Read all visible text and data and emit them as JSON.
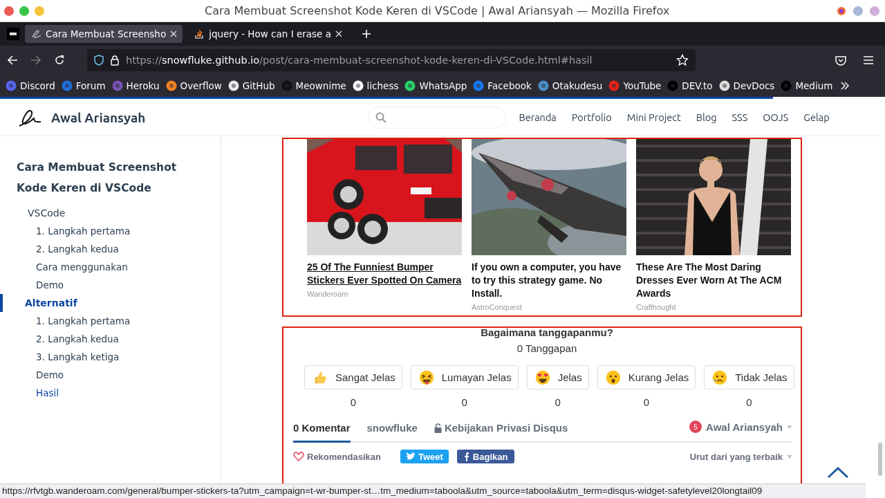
{
  "window": {
    "title": "Cara Membuat Screenshot Kode Keren di VSCode | Awal Ariansyah — Mozilla Firefox"
  },
  "tabs": [
    {
      "label": "Cara Membuat Screensho",
      "selected": true
    },
    {
      "label": "jquery - How can I erase a",
      "selected": false
    }
  ],
  "address_bar": {
    "scheme": "https://",
    "domain": "snowfluke.github.io",
    "path": "/post/cara-membuat-screenshot-kode-keren-di-VSCode.html#hasil"
  },
  "bookmarks": [
    "Discord",
    "Forum",
    "Heroku",
    "Overflow",
    "GitHub",
    "Meownime",
    "lichess",
    "WhatsApp",
    "Facebook",
    "Otakudesu",
    "YouTube",
    "DEV.to",
    "DevDocs",
    "Medium"
  ],
  "site": {
    "name": "Awal Ariansyah",
    "nav": [
      "Beranda",
      "Portfolio",
      "Mini Project",
      "Blog",
      "SSS",
      "OOJS",
      "Gelap"
    ]
  },
  "toc": {
    "title": "Cara Membuat Screenshot Kode Keren di VSCode",
    "items": [
      {
        "label": "VSCode",
        "selected": false,
        "children": [
          {
            "label": "1. Langkah pertama",
            "selected": false
          },
          {
            "label": "2. Langkah kedua",
            "selected": false
          },
          {
            "label": "Cara menggunakan",
            "selected": false
          },
          {
            "label": "Demo",
            "selected": false
          }
        ]
      },
      {
        "label": "Alternatif",
        "selected": true,
        "children": [
          {
            "label": "1. Langkah pertama",
            "selected": false
          },
          {
            "label": "2. Langkah kedua",
            "selected": false
          },
          {
            "label": "3. Langkah ketiga",
            "selected": false
          },
          {
            "label": "Demo",
            "selected": false
          },
          {
            "label": "Hasil",
            "selected": true
          }
        ]
      }
    ]
  },
  "ads": [
    {
      "title": "25 Of The Funniest Bumper Stickers Ever Spotted On Camera",
      "source": "Wanderoam",
      "hovered": true
    },
    {
      "title": "If you own a computer, you have to try this strategy game. No Install.",
      "source": "AstroConquest",
      "hovered": false
    },
    {
      "title": "These Are The Most Daring Dresses Ever Worn At The ACM Awards",
      "source": "Crafthought",
      "hovered": false
    }
  ],
  "reactions": {
    "question": "Bagaimana tanggapanmu?",
    "total": "0 Tanggapan",
    "items": [
      {
        "label": "Sangat Jelas",
        "count": "0"
      },
      {
        "label": "Lumayan Jelas",
        "count": "0"
      },
      {
        "label": "Jelas",
        "count": "0"
      },
      {
        "label": "Kurang Jelas",
        "count": "0"
      },
      {
        "label": "Tidak Jelas",
        "count": "0"
      }
    ]
  },
  "comments": {
    "tabs": [
      {
        "label": "0 Komentar",
        "selected": true
      },
      {
        "label": "snowfluke",
        "selected": false
      },
      {
        "label": "Kebijakan Privasi Disqus",
        "selected": false
      }
    ],
    "user": {
      "name": "Awal Ariansyah",
      "badge": "5"
    },
    "recommend": "Rekomendasikan",
    "tweet": "Tweet",
    "share": "Bagikan",
    "sort": "Urut dari yang terbaik"
  },
  "status_bar": "https://rfvtgb.wanderoam.com/general/bumper-stickers-ta?utm_campaign=t-wr-bumper-st…tm_medium=taboola&utm_source=taboola&utm_term=disqus-widget-safetylevel20longtail09"
}
